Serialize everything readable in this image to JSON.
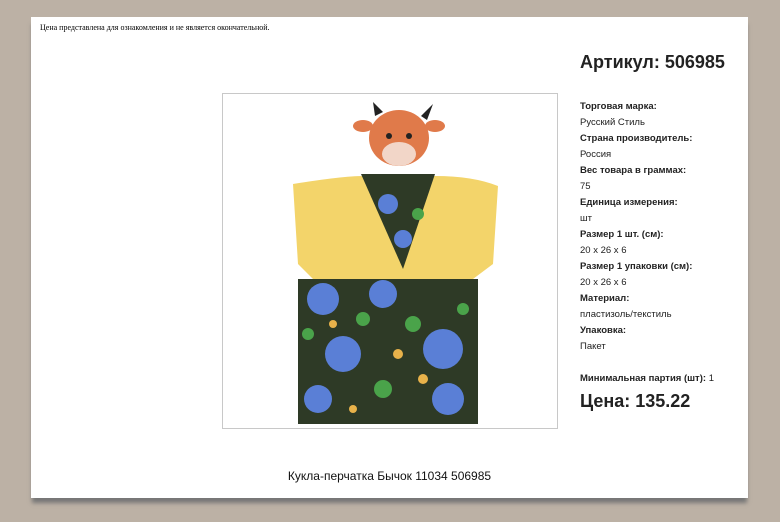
{
  "notice": "Цена представлена для ознакомления и не является окончательной.",
  "article": "Артикул: 506985",
  "specs": [
    {
      "label": "Торговая марка:",
      "value": "Русский Стиль"
    },
    {
      "label": "Страна производитель:",
      "value": "Россия"
    },
    {
      "label": "Вес товара в граммах:",
      "value": "75"
    },
    {
      "label": "Единица измерения:",
      "value": "шт"
    },
    {
      "label": "Размер 1 шт. (см):",
      "value": "20 x 26 x 6"
    },
    {
      "label": "Размер 1 упаковки (см):",
      "value": "20 x 26 x 6"
    },
    {
      "label": "Материал:",
      "value": "пластизоль/текстиль"
    },
    {
      "label": "Упаковка:",
      "value": "Пакет"
    }
  ],
  "min_lot": {
    "label": "Минимальная партия (шт):",
    "value": "1"
  },
  "price": "Цена: 135.22",
  "product_name": "Кукла-перчатка Бычок 11034 506985"
}
